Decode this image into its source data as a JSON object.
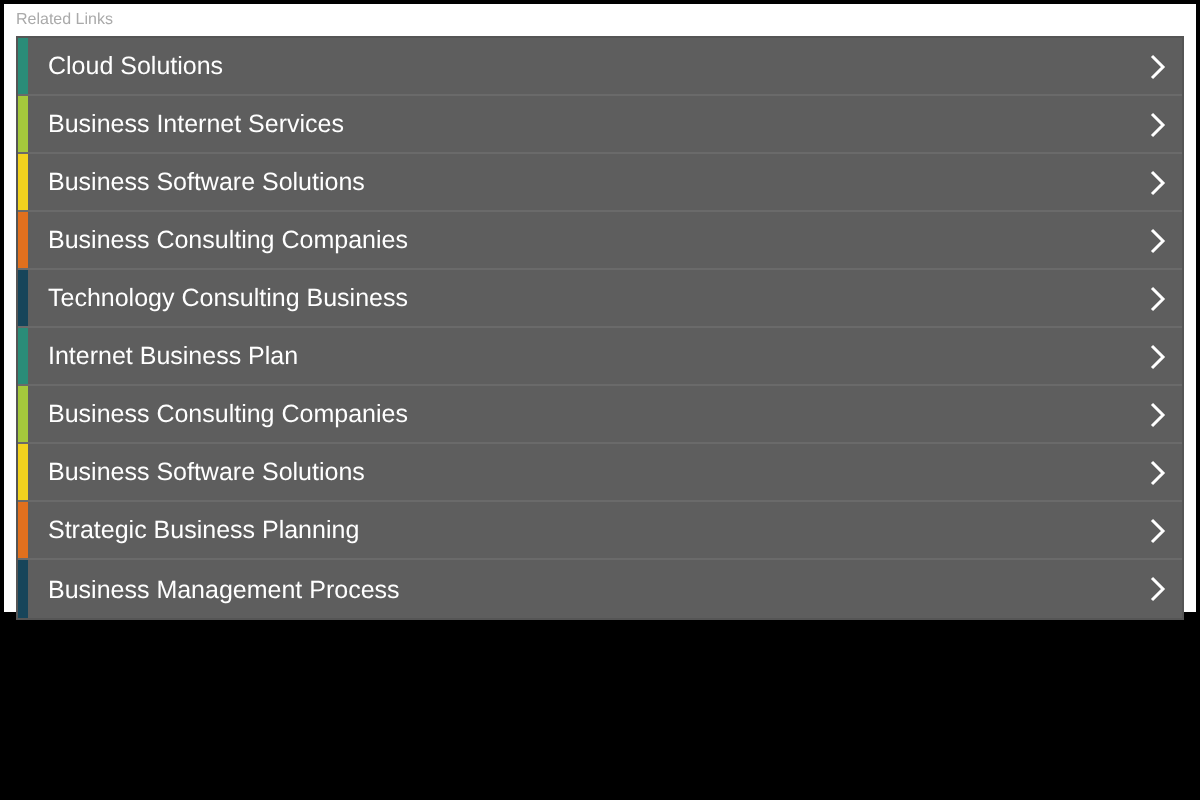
{
  "panel": {
    "title": "Related Links",
    "links": [
      {
        "label": "Cloud Solutions",
        "color": "#2a8c78"
      },
      {
        "label": "Business Internet Services",
        "color": "#a4c83c"
      },
      {
        "label": "Business Software Solutions",
        "color": "#f2d21e"
      },
      {
        "label": "Business Consulting Companies",
        "color": "#e2701e"
      },
      {
        "label": "Technology Consulting Business",
        "color": "#17455a"
      },
      {
        "label": "Internet Business Plan",
        "color": "#2a8c78"
      },
      {
        "label": "Business Consulting Companies",
        "color": "#a4c83c"
      },
      {
        "label": "Business Software Solutions",
        "color": "#f2d21e"
      },
      {
        "label": "Strategic Business Planning",
        "color": "#e2701e"
      },
      {
        "label": "Business Management Process",
        "color": "#17455a"
      }
    ]
  }
}
